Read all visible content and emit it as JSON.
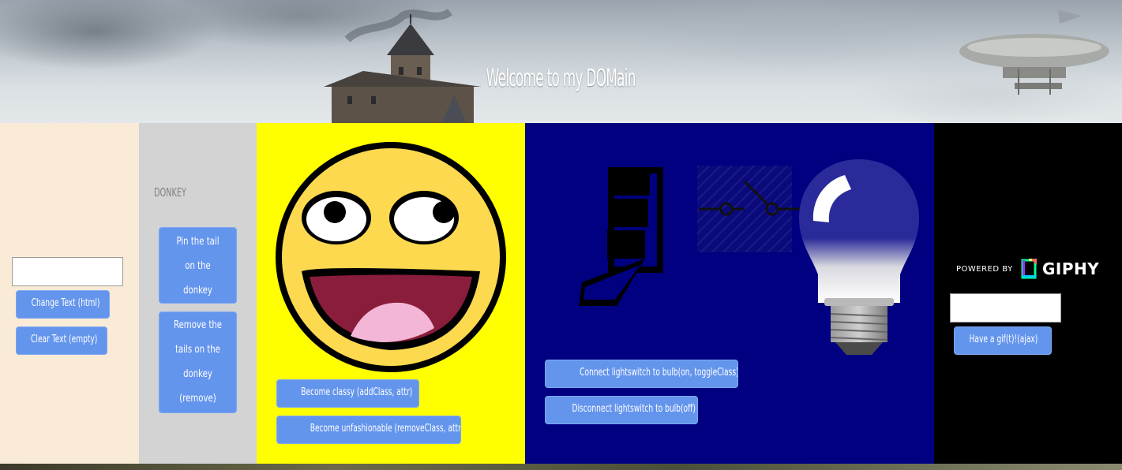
{
  "header": {
    "title": "Welcome to my DOMain"
  },
  "panel_text": {
    "input_value": "",
    "change_text_label": "Change Text (html)",
    "clear_text_label": "Clear Text (empty)"
  },
  "panel_donkey": {
    "donkey_label": "DONKEY",
    "append_label": "Pin the tail on the donkey (append)",
    "remove_label": "Remove the tails on the donkey (remove)"
  },
  "panel_smiley": {
    "add_class_label": "Become classy (addClass, attr)",
    "remove_class_label": "Become unfashionable (removeClass, attr)"
  },
  "panel_light": {
    "connect_label": "Connect lightswitch to bulb(on, toggleClass)",
    "disconnect_label": "Disconnect lightswitch to bulb(off)"
  },
  "panel_giphy": {
    "powered_by": "POWERED BY",
    "brand": "GIPHY",
    "search_value": "",
    "ajax_label": "Have a gif(t)!(ajax)"
  },
  "colors": {
    "panel_text_bg": "#faebd7",
    "panel_donkey_bg": "#d3d3d3",
    "panel_smiley_bg": "#ffff00",
    "panel_light_bg": "#000080",
    "panel_giphy_bg": "#000000",
    "button_bg": "#6495ed"
  },
  "icons": {
    "smiley": "awesome-face-icon",
    "switch": "lever-switch-icon",
    "circuit": "circuit-switch-icon",
    "bulb": "light-bulb-icon",
    "giphy": "giphy-logo-icon"
  }
}
